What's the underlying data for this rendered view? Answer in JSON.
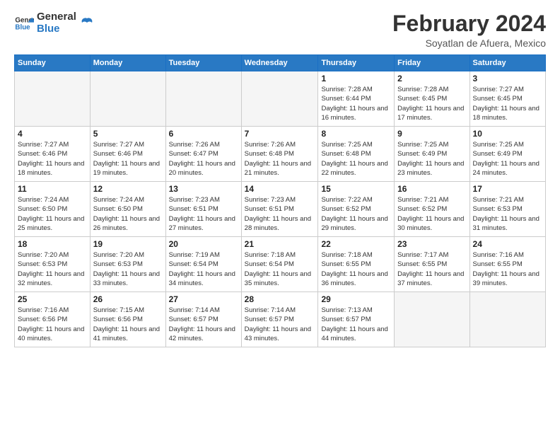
{
  "header": {
    "logo_line1": "General",
    "logo_line2": "Blue",
    "title": "February 2024",
    "subtitle": "Soyatlan de Afuera, Mexico"
  },
  "weekdays": [
    "Sunday",
    "Monday",
    "Tuesday",
    "Wednesday",
    "Thursday",
    "Friday",
    "Saturday"
  ],
  "weeks": [
    [
      {
        "day": "",
        "info": ""
      },
      {
        "day": "",
        "info": ""
      },
      {
        "day": "",
        "info": ""
      },
      {
        "day": "",
        "info": ""
      },
      {
        "day": "1",
        "info": "Sunrise: 7:28 AM\nSunset: 6:44 PM\nDaylight: 11 hours\nand 16 minutes."
      },
      {
        "day": "2",
        "info": "Sunrise: 7:28 AM\nSunset: 6:45 PM\nDaylight: 11 hours\nand 17 minutes."
      },
      {
        "day": "3",
        "info": "Sunrise: 7:27 AM\nSunset: 6:45 PM\nDaylight: 11 hours\nand 18 minutes."
      }
    ],
    [
      {
        "day": "4",
        "info": "Sunrise: 7:27 AM\nSunset: 6:46 PM\nDaylight: 11 hours\nand 18 minutes."
      },
      {
        "day": "5",
        "info": "Sunrise: 7:27 AM\nSunset: 6:46 PM\nDaylight: 11 hours\nand 19 minutes."
      },
      {
        "day": "6",
        "info": "Sunrise: 7:26 AM\nSunset: 6:47 PM\nDaylight: 11 hours\nand 20 minutes."
      },
      {
        "day": "7",
        "info": "Sunrise: 7:26 AM\nSunset: 6:48 PM\nDaylight: 11 hours\nand 21 minutes."
      },
      {
        "day": "8",
        "info": "Sunrise: 7:25 AM\nSunset: 6:48 PM\nDaylight: 11 hours\nand 22 minutes."
      },
      {
        "day": "9",
        "info": "Sunrise: 7:25 AM\nSunset: 6:49 PM\nDaylight: 11 hours\nand 23 minutes."
      },
      {
        "day": "10",
        "info": "Sunrise: 7:25 AM\nSunset: 6:49 PM\nDaylight: 11 hours\nand 24 minutes."
      }
    ],
    [
      {
        "day": "11",
        "info": "Sunrise: 7:24 AM\nSunset: 6:50 PM\nDaylight: 11 hours\nand 25 minutes."
      },
      {
        "day": "12",
        "info": "Sunrise: 7:24 AM\nSunset: 6:50 PM\nDaylight: 11 hours\nand 26 minutes."
      },
      {
        "day": "13",
        "info": "Sunrise: 7:23 AM\nSunset: 6:51 PM\nDaylight: 11 hours\nand 27 minutes."
      },
      {
        "day": "14",
        "info": "Sunrise: 7:23 AM\nSunset: 6:51 PM\nDaylight: 11 hours\nand 28 minutes."
      },
      {
        "day": "15",
        "info": "Sunrise: 7:22 AM\nSunset: 6:52 PM\nDaylight: 11 hours\nand 29 minutes."
      },
      {
        "day": "16",
        "info": "Sunrise: 7:21 AM\nSunset: 6:52 PM\nDaylight: 11 hours\nand 30 minutes."
      },
      {
        "day": "17",
        "info": "Sunrise: 7:21 AM\nSunset: 6:53 PM\nDaylight: 11 hours\nand 31 minutes."
      }
    ],
    [
      {
        "day": "18",
        "info": "Sunrise: 7:20 AM\nSunset: 6:53 PM\nDaylight: 11 hours\nand 32 minutes."
      },
      {
        "day": "19",
        "info": "Sunrise: 7:20 AM\nSunset: 6:53 PM\nDaylight: 11 hours\nand 33 minutes."
      },
      {
        "day": "20",
        "info": "Sunrise: 7:19 AM\nSunset: 6:54 PM\nDaylight: 11 hours\nand 34 minutes."
      },
      {
        "day": "21",
        "info": "Sunrise: 7:18 AM\nSunset: 6:54 PM\nDaylight: 11 hours\nand 35 minutes."
      },
      {
        "day": "22",
        "info": "Sunrise: 7:18 AM\nSunset: 6:55 PM\nDaylight: 11 hours\nand 36 minutes."
      },
      {
        "day": "23",
        "info": "Sunrise: 7:17 AM\nSunset: 6:55 PM\nDaylight: 11 hours\nand 37 minutes."
      },
      {
        "day": "24",
        "info": "Sunrise: 7:16 AM\nSunset: 6:55 PM\nDaylight: 11 hours\nand 39 minutes."
      }
    ],
    [
      {
        "day": "25",
        "info": "Sunrise: 7:16 AM\nSunset: 6:56 PM\nDaylight: 11 hours\nand 40 minutes."
      },
      {
        "day": "26",
        "info": "Sunrise: 7:15 AM\nSunset: 6:56 PM\nDaylight: 11 hours\nand 41 minutes."
      },
      {
        "day": "27",
        "info": "Sunrise: 7:14 AM\nSunset: 6:57 PM\nDaylight: 11 hours\nand 42 minutes."
      },
      {
        "day": "28",
        "info": "Sunrise: 7:14 AM\nSunset: 6:57 PM\nDaylight: 11 hours\nand 43 minutes."
      },
      {
        "day": "29",
        "info": "Sunrise: 7:13 AM\nSunset: 6:57 PM\nDaylight: 11 hours\nand 44 minutes."
      },
      {
        "day": "",
        "info": ""
      },
      {
        "day": "",
        "info": ""
      }
    ]
  ]
}
